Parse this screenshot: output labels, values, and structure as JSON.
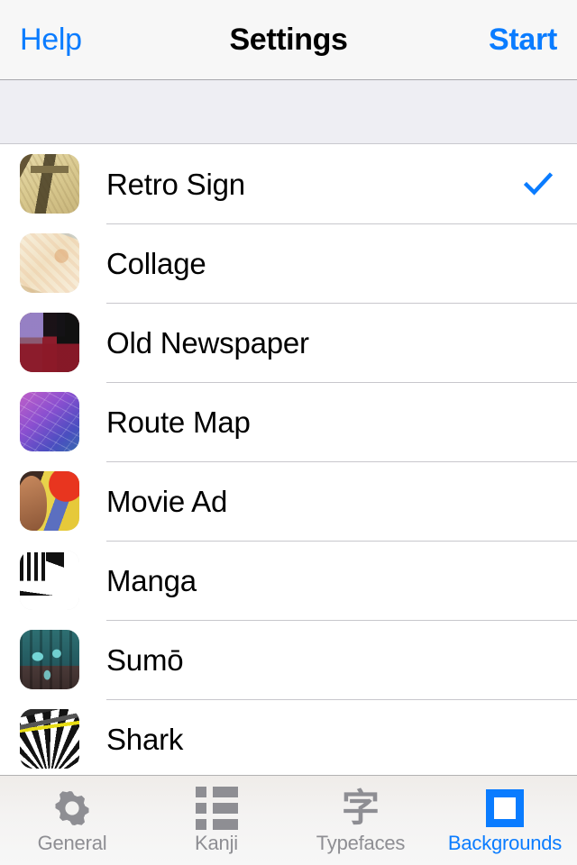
{
  "navbar": {
    "left_label": "Help",
    "title": "Settings",
    "right_label": "Start"
  },
  "section": {
    "header_text": ""
  },
  "list": {
    "rows": [
      {
        "label": "Retro Sign",
        "thumb": "retro-sign-thumbnail",
        "selected": true,
        "check": "checkmark-icon"
      },
      {
        "label": "Collage",
        "thumb": "collage-thumbnail",
        "selected": false,
        "check": ""
      },
      {
        "label": "Old Newspaper",
        "thumb": "old-newspaper-thumbnail",
        "selected": false,
        "check": ""
      },
      {
        "label": "Route Map",
        "thumb": "route-map-thumbnail",
        "selected": false,
        "check": ""
      },
      {
        "label": "Movie Ad",
        "thumb": "movie-ad-thumbnail",
        "selected": false,
        "check": ""
      },
      {
        "label": "Manga",
        "thumb": "manga-thumbnail",
        "selected": false,
        "check": ""
      },
      {
        "label": "Sumō",
        "thumb": "sumo-thumbnail",
        "selected": false,
        "check": ""
      },
      {
        "label": "Shark",
        "thumb": "shark-thumbnail",
        "selected": false,
        "check": ""
      }
    ]
  },
  "tabbar": {
    "tabs": [
      {
        "label": "General",
        "icon": "gear-icon",
        "active": false
      },
      {
        "label": "Kanji",
        "icon": "list-icon",
        "active": false
      },
      {
        "label": "Typefaces",
        "icon": "kanji-ji-icon",
        "active": false,
        "glyph": "字"
      },
      {
        "label": "Backgrounds",
        "icon": "square-icon",
        "active": true
      }
    ]
  },
  "colors": {
    "accent_blue": "#0a7cff",
    "navbar_bg": "#f7f7f7",
    "section_band_bg": "#eeeef3",
    "tab_inactive": "#8e8e93",
    "separator": "#c8c7cc",
    "text_primary": "#000000"
  }
}
